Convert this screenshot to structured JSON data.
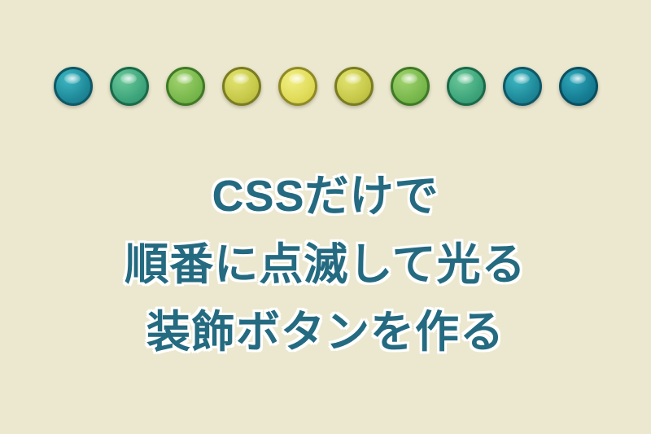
{
  "dots": [
    {
      "name": "dot-1-teal"
    },
    {
      "name": "dot-2-teal-green"
    },
    {
      "name": "dot-3-green"
    },
    {
      "name": "dot-4-yellow-green"
    },
    {
      "name": "dot-5-yellow"
    },
    {
      "name": "dot-6-yellow-green"
    },
    {
      "name": "dot-7-green"
    },
    {
      "name": "dot-8-teal-green"
    },
    {
      "name": "dot-9-teal"
    },
    {
      "name": "dot-10-teal-dark"
    }
  ],
  "title": {
    "line1": "CSSだけで",
    "line2": "順番に点滅して光る",
    "line3": "装飾ボタンを作る"
  }
}
